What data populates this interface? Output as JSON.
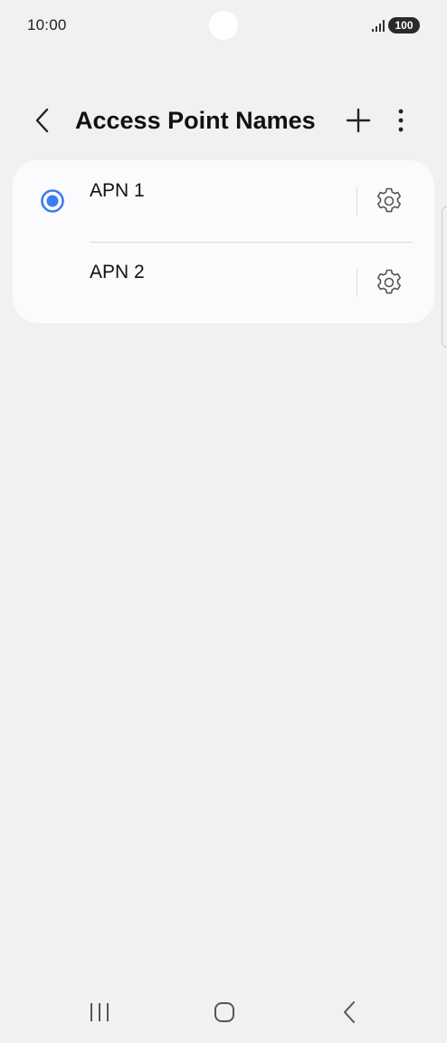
{
  "status_bar": {
    "time": "10:00",
    "battery": "100",
    "icons": [
      "signal-icon",
      "battery-icon"
    ]
  },
  "header": {
    "title": "Access Point Names",
    "icons": [
      "back-arrow-icon",
      "plus-icon",
      "more-vertical-icon"
    ]
  },
  "apn_list": [
    {
      "label": "APN 1",
      "selected": true
    },
    {
      "label": "APN 2",
      "selected": false
    }
  ],
  "colors": {
    "accent": "#3e7bf0",
    "background": "#f1f1f3",
    "card": "#fbfbfd"
  },
  "nav_bar": {
    "icons": [
      "recents-icon",
      "home-icon",
      "back-icon"
    ]
  }
}
